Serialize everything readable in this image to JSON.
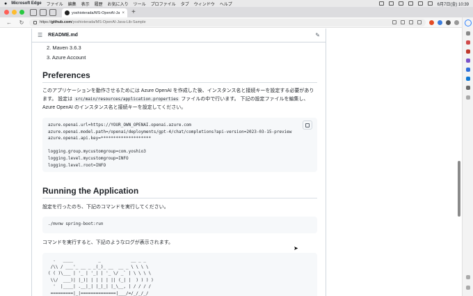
{
  "menubar": {
    "app_name": "Microsoft Edge",
    "items": [
      "ファイル",
      "編集",
      "表示",
      "履歴",
      "お気に入り",
      "ツール",
      "プロファイル",
      "タブ",
      "ウィンドウ",
      "ヘルプ"
    ],
    "clock": "6月7日(金) 10:39"
  },
  "tabbar": {
    "active_tab_title": "yoshioterada/MS-OpenAI-Java-",
    "close_glyph": "×",
    "new_tab_glyph": "+"
  },
  "addressbar": {
    "url_prefix": "https://",
    "url_host": "github.com",
    "url_path": "/yoshioterada/MS-OpenAI-Java-Lib-Sample"
  },
  "file": {
    "name": "README.md"
  },
  "content": {
    "list_items": [
      "2. Maven 3.6.3",
      "3. Azure Account"
    ],
    "preferences_heading": "Preferences",
    "preferences_p1a": "このアプリケーションを動作させるためには Azure OpenAI を作成した後、インスタンス名と接続キーを設定する必要があります。 設定は ",
    "preferences_p1_code": "src/main/resources/application.properties",
    "preferences_p1b": " ファイルの中で行います。 下記の設定ファイルを編集し、Azure OpenAI のインスタンス名と接続キーを設定してください。",
    "config_code": "azure.openai.url=https://YOUR_OWN_OPENAI.openai.azure.com\nazure.openai.model.path=/openai/deployments/gpt-4/chat/completions?api-version=2023-03-15-preview\nazure.openai.api.key=********************\n\nlogging.group.mycustomgroup=com.yoshio3\nlogging.level.mycustomgroup=INFO\nlogging.level.root=INFO",
    "running_heading": "Running the Application",
    "running_p1": "設定を行ったのち、下記のコマンドを実行してください。",
    "run_code": "./mvnw spring-boot:run",
    "running_p2": "コマンドを実行すると、下記のようなログが表示されます。",
    "log_code": "  .   ____          _            __ _ _\n /\\\\ / ___'_ __ _ _(_)_ __  __ _ \\ \\ \\ \\\n( ( )\\___ | '_ | '_| | '_ \\/ _` | \\ \\ \\ \\\n \\\\/  ___)| |_)| | | | | || (_| |  ) ) ) )\n  '  |____| .__|_| |_|_| |_\\__, | / / / /\n =========|_|==============|___/=/_/_/_/"
  },
  "colors": {
    "link_blue": "#0969da",
    "border": "#d0d7de",
    "code_bg": "#f6f8fa"
  }
}
